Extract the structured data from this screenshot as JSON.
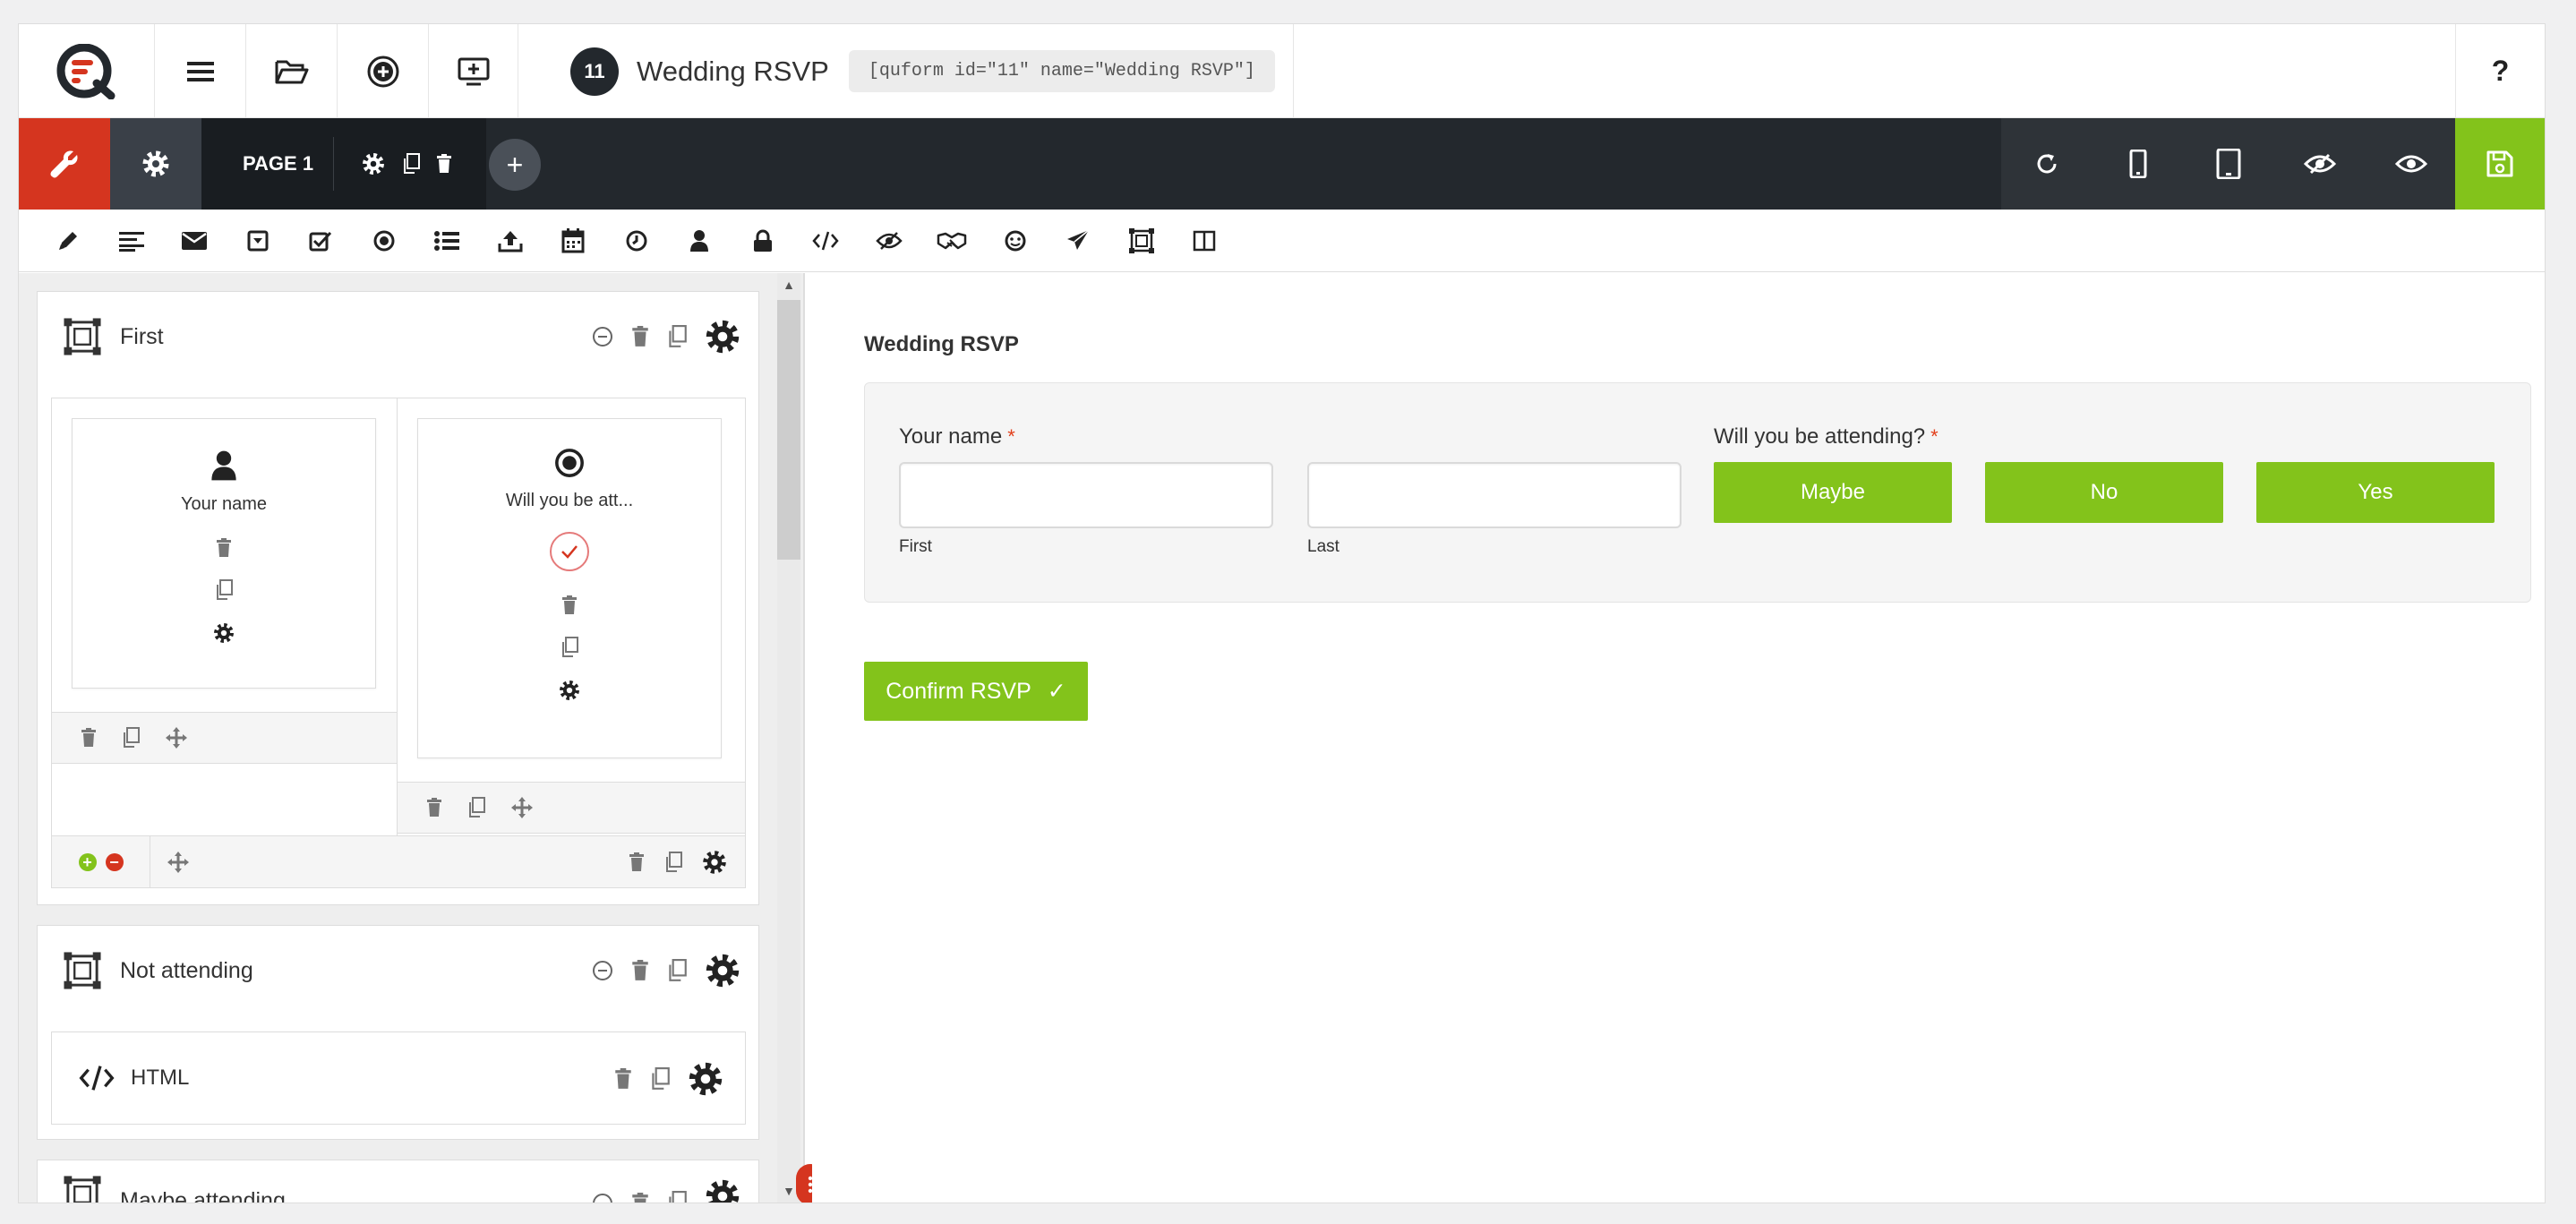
{
  "header": {
    "form_id": "11",
    "form_title": "Wedding RSVP",
    "shortcode": "[quform id=\"11\" name=\"Wedding RSVP\"]",
    "help_label": "?"
  },
  "toolbar": {
    "page_label": "PAGE 1",
    "add_page_label": "+"
  },
  "builder": {
    "groups": [
      {
        "title": "First",
        "columns": [
          {
            "element_label": "Your name"
          },
          {
            "element_label": "Will you be att..."
          }
        ]
      },
      {
        "title": "Not attending",
        "element_label": "HTML"
      },
      {
        "title": "Maybe attending"
      }
    ]
  },
  "preview": {
    "form_title": "Wedding RSVP",
    "name_label": "Your name",
    "name_required": "*",
    "first_sublabel": "First",
    "last_sublabel": "Last",
    "attending_label": "Will you be attending?",
    "attending_required": "*",
    "choices": [
      "Maybe",
      "No",
      "Yes"
    ],
    "submit_label": "Confirm RSVP",
    "submit_check": "✓"
  },
  "colors": {
    "accent_green": "#83c31b",
    "accent_red": "#d5351f",
    "dark_toolbar": "#23282d"
  },
  "icons": {
    "header": [
      "quform-logo",
      "menu-icon",
      "folder-open-icon",
      "add-form-icon",
      "embed-icon"
    ],
    "fields_toolbar": [
      "pencil-icon",
      "textarea-icon",
      "email-icon",
      "select-icon",
      "checkbox-icon",
      "radio-icon",
      "list-icon",
      "upload-icon",
      "calendar-icon",
      "clock-icon",
      "name-icon",
      "password-icon",
      "html-icon",
      "hidden-icon",
      "handshake-icon",
      "captcha-icon",
      "submit-icon",
      "group-icon",
      "column-icon"
    ],
    "right_tools": [
      "refresh-icon",
      "phone-icon",
      "tablet-icon",
      "hide-preview-icon",
      "preview-icon",
      "save-icon"
    ]
  }
}
